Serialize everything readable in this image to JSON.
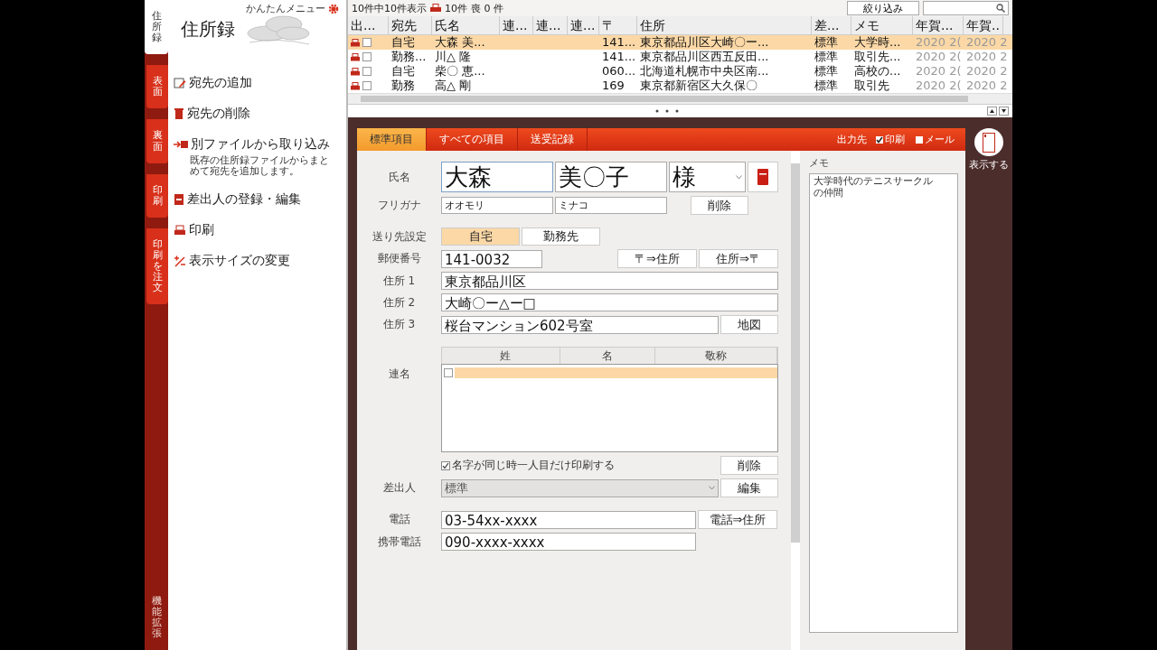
{
  "side_tabs": [
    {
      "label": "住所録",
      "selected": true
    },
    {
      "label": "表面",
      "selected": false
    },
    {
      "label": "裏面",
      "selected": false
    },
    {
      "label": "印刷",
      "selected": false
    },
    {
      "label": "印刷を注文",
      "selected": false
    }
  ],
  "side_bottom": "機能拡張",
  "menu": {
    "easy_menu": "かんたんメニュー",
    "title": "住所録",
    "items": [
      {
        "label": "宛先の追加"
      },
      {
        "label": "宛先の削除"
      },
      {
        "label": "別ファイルから取り込み",
        "note": "既存の住所録ファイルからまとめて宛先を追加します。"
      },
      {
        "label": "差出人の登録・編集"
      },
      {
        "label": "印刷"
      },
      {
        "label": "表示サイズの変更"
      }
    ]
  },
  "list": {
    "shown": "10件中10件表示",
    "print_count": "10件",
    "mourning_count": "喪 0 件",
    "filter_button": "絞り込み",
    "columns": [
      "出...",
      "宛先",
      "氏名",
      "連...",
      "連...",
      "連...",
      "〒",
      "住所",
      "差...",
      "メモ",
      "年賀...",
      "年賀.."
    ],
    "rows": [
      {
        "selected": true,
        "checked": false,
        "dest": "自宅",
        "name": "大森 美...",
        "zip": "141...",
        "address": "東京都品川区大崎〇ー...",
        "sender": "標準",
        "memo": "大学時...",
        "nenga_1": "2020 2(",
        "nenga_2": "2020 2"
      },
      {
        "selected": false,
        "checked": false,
        "dest": "勤務...",
        "name": "川△ 隆",
        "zip": "141...",
        "address": "東京都品川区西五反田...",
        "sender": "標準",
        "memo": "取引先...",
        "nenga_1": "2020 2(",
        "nenga_2": "2020 2"
      },
      {
        "selected": false,
        "checked": false,
        "dest": "自宅",
        "name": "柴〇 恵...",
        "zip": "060...",
        "address": "北海道札幌市中央区南...",
        "sender": "標準",
        "memo": "高校の...",
        "nenga_1": "2020 2(",
        "nenga_2": "2020 2"
      },
      {
        "selected": false,
        "checked": false,
        "dest": "勤務",
        "name": "高△ 剛",
        "zip": "169",
        "address": "東京都新宿区大久保〇",
        "sender": "標準",
        "memo": "取引先",
        "nenga_1": "2020 2(",
        "nenga_2": "2020 2"
      }
    ]
  },
  "form": {
    "tabs": [
      {
        "label": "標準項目",
        "selected": true
      },
      {
        "label": "すべての項目",
        "selected": false
      },
      {
        "label": "送受記録",
        "selected": false
      }
    ],
    "output": {
      "label": "出力先",
      "options": [
        {
          "label": "印刷",
          "checked": true
        },
        {
          "label": "メール",
          "checked": false
        }
      ]
    },
    "name": {
      "label": "氏名",
      "last": "大森",
      "first": "美〇子",
      "honorific": "様"
    },
    "furigana": {
      "label": "フリガナ",
      "last": "オオモリ",
      "first": "ミナコ",
      "delete_button": "削除"
    },
    "destination": {
      "label": "送り先設定",
      "options": [
        {
          "label": "自宅",
          "selected": true
        },
        {
          "label": "勤務先",
          "selected": false
        }
      ]
    },
    "postal": {
      "label": "郵便番号",
      "value": "141-0032",
      "buttons": [
        "〒⇒住所",
        "住所⇒〒"
      ]
    },
    "address_1": {
      "label": "住所 1",
      "value": "東京都品川区"
    },
    "address_2": {
      "label": "住所 2",
      "value": "大崎〇ー△ー□"
    },
    "address_3": {
      "label": "住所 3",
      "value": "桜台マンション602号室",
      "map_button": "地図"
    },
    "joint_names": {
      "label": "連名",
      "columns": [
        "姓",
        "名",
        "敬称"
      ],
      "rows": [
        {
          "checked": false,
          "selected": true
        }
      ],
      "same_surname": {
        "label": "名字が同じ時一人目だけ印刷する",
        "checked": true
      },
      "delete_button": "削除"
    },
    "sender": {
      "label": "差出人",
      "value": "標準",
      "edit_button": "編集"
    },
    "phone": {
      "label": "電話",
      "value": "03-54xx-xxxx",
      "button": "電話⇒住所"
    },
    "mobile": {
      "label": "携帯電話",
      "value": "090-xxxx-xxxx"
    },
    "memo": {
      "label": "メモ",
      "value": "大学時代のテニスサークルの仲間"
    }
  },
  "show_button": "表示する"
}
